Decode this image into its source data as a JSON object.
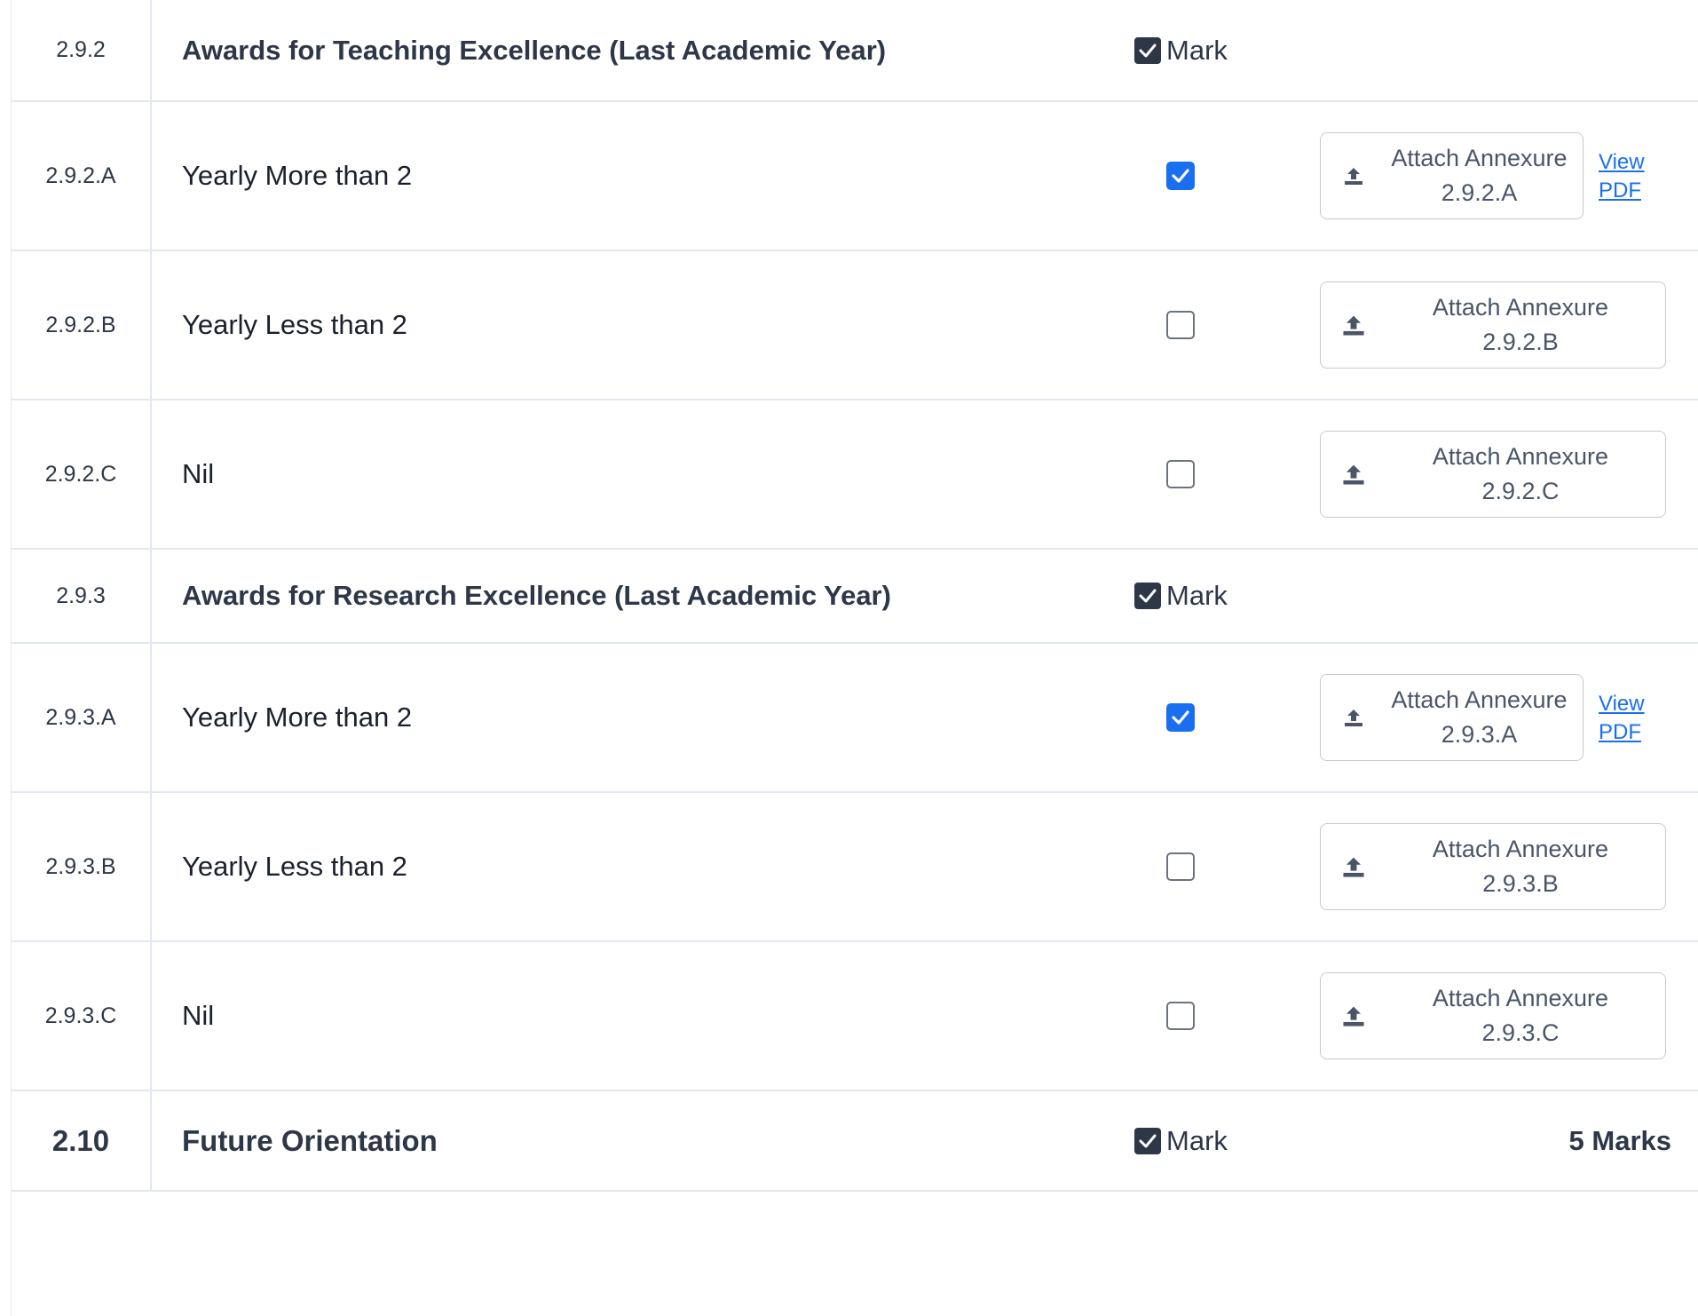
{
  "sections": [
    {
      "code": "2.9.2",
      "title": "Awards for Teaching Excellence (Last Academic Year)",
      "mark_label": "Mark",
      "options": [
        {
          "code": "2.9.2.A",
          "label": "Yearly More than 2",
          "checked": true,
          "attach_line1": "Attach Annexure",
          "attach_line2": "2.9.2.A",
          "view_line1": "View",
          "view_line2": "PDF"
        },
        {
          "code": "2.9.2.B",
          "label": "Yearly Less than 2",
          "checked": false,
          "attach_line1": "Attach Annexure",
          "attach_line2": "2.9.2.B"
        },
        {
          "code": "2.9.2.C",
          "label": "Nil",
          "checked": false,
          "attach_line1": "Attach Annexure",
          "attach_line2": "2.9.2.C"
        }
      ]
    },
    {
      "code": "2.9.3",
      "title": "Awards for Research Excellence (Last Academic Year)",
      "mark_label": "Mark",
      "options": [
        {
          "code": "2.9.3.A",
          "label": "Yearly More than 2",
          "checked": true,
          "attach_line1": "Attach Annexure",
          "attach_line2": "2.9.3.A",
          "view_line1": "View",
          "view_line2": "PDF"
        },
        {
          "code": "2.9.3.B",
          "label": "Yearly Less than 2",
          "checked": false,
          "attach_line1": "Attach Annexure",
          "attach_line2": "2.9.3.B"
        },
        {
          "code": "2.9.3.C",
          "label": "Nil",
          "checked": false,
          "attach_line1": "Attach Annexure",
          "attach_line2": "2.9.3.C"
        }
      ]
    }
  ],
  "next_section": {
    "code": "2.10",
    "title": "Future Orientation",
    "mark_label": "Mark",
    "total_marks": "5 Marks"
  },
  "colors": {
    "accent": "#1a6ff0",
    "text": "#2d3748",
    "border": "#e2e8f0"
  },
  "icons": {
    "mark": "checkbox-checked-icon",
    "attach": "upload-icon"
  }
}
